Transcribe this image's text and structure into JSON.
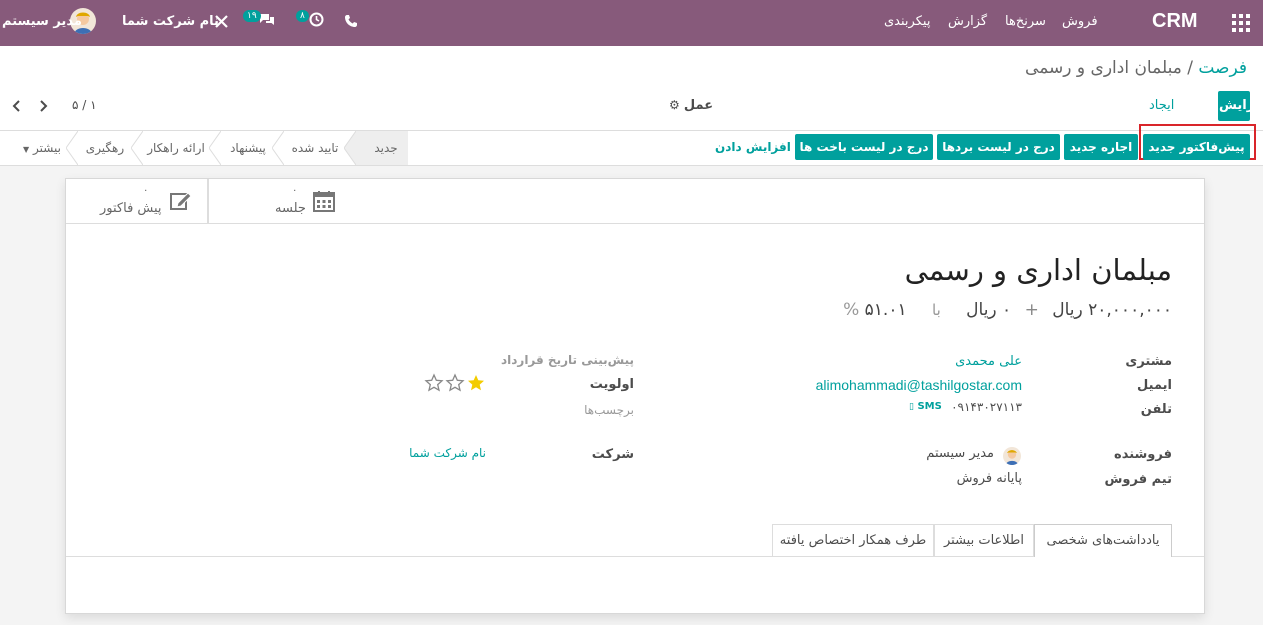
{
  "navbar": {
    "app_name": "CRM",
    "menu": [
      "فروش",
      "سرنخ‌ها",
      "گزارش",
      "پیکربندی"
    ],
    "user": "مدیر سیستم",
    "company": "نام شرکت شما",
    "messages_count": "۱۹",
    "activities_count": "۸"
  },
  "breadcrumb": {
    "parent": "فرصت",
    "separator": "/",
    "current": "مبلمان اداری و رسمی"
  },
  "control": {
    "edit_label": "ویرایش",
    "create_label": "ایجاد",
    "action_label": "عمل",
    "pager": "۵ / ۱"
  },
  "actions": {
    "new_quote": "پیش‌فاکتور جدید",
    "new_rental": "اجاره جدید",
    "mark_won": "درج در لیست بردها",
    "mark_lost": "درج در لیست باخت ها",
    "enrich": "افزایش دادن"
  },
  "stages": {
    "new": "جدید",
    "qualified": "تایید شده",
    "proposition": "پیشنهاد",
    "solution": "ارائه راهکار",
    "tracking": "رهگیری",
    "more": "بیشتر"
  },
  "smart_buttons": {
    "meeting_count": "۰",
    "meeting_label": "جلسه",
    "quote_count": "۰",
    "quote_label": "پیش فاکتور"
  },
  "record": {
    "title": "مبلمان اداری و رسمی",
    "revenue": "۲۰,۰۰۰,۰۰۰",
    "currency": "ریال",
    "plus": "+",
    "recurring": "۰",
    "recurring_currency": "ریال",
    "with": "با",
    "probability": "۵۱.۰۱",
    "percent": "%"
  },
  "fields": {
    "customer_label": "مشتری",
    "customer": "علی محمدی",
    "email_label": "ایمیل",
    "email": "alimohammadi@tashilgostar.com",
    "phone_label": "تلفن",
    "phone": "۰۹۱۴۳۰۲۷۱۱۳",
    "sms": "SMS",
    "deadline_label": "پیش‌بینی تاریخ قرارداد",
    "priority_label": "اولویت",
    "priority_value": 1,
    "priority_max": 3,
    "tags_label": "برچسب‌ها",
    "salesperson_label": "فروشنده",
    "salesperson": "مدیر سیستم",
    "team_label": "تیم فروش",
    "team": "پایانه فروش",
    "company_label": "شرکت",
    "company": "نام شرکت شما"
  },
  "tabs": [
    "یادداشت‌های شخصی",
    "اطلاعات بیشتر",
    "طرف همکار اختصاص یافته"
  ],
  "colors": {
    "navbar": "#875a7b",
    "accent": "#00a09d",
    "highlight": "#d9252a",
    "star": "#f3cc00"
  }
}
